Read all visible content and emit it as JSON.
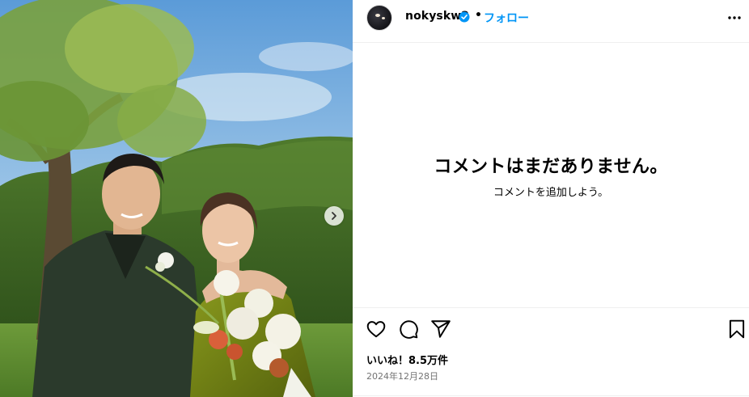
{
  "post": {
    "image_alt": "photo",
    "next_icon": "chevron-right-icon"
  },
  "header": {
    "username": "nokyskw2",
    "separator": "•",
    "follow_label": "フォロー",
    "more_icon": "more-horizontal-icon",
    "verified_icon": "verified-badge-icon"
  },
  "comments": {
    "empty_title": "コメントはまだありません。",
    "empty_subtitle": "コメントを追加しよう。"
  },
  "actions": {
    "like_icon": "heart-icon",
    "comment_icon": "comment-icon",
    "share_icon": "share-icon",
    "save_icon": "bookmark-icon"
  },
  "stats": {
    "likes": "いいね！8.5万件",
    "date": "2024年12月28日"
  },
  "colors": {
    "accent": "#0095f6",
    "muted": "#737373"
  }
}
